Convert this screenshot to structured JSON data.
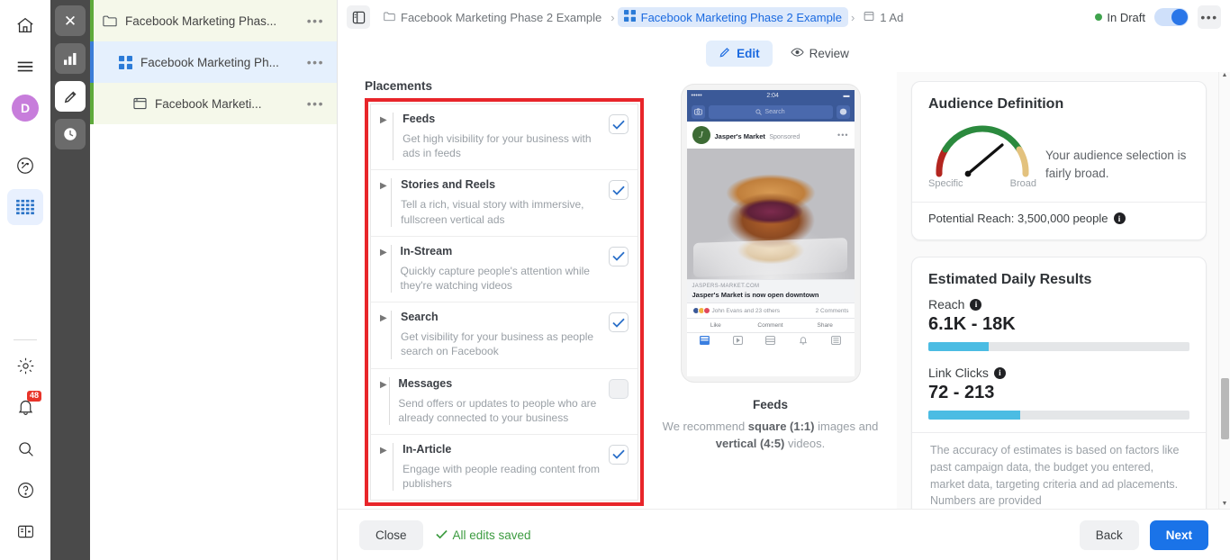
{
  "rail": {
    "items": [
      {
        "name": "home-icon",
        "label": "Home"
      },
      {
        "name": "menu-icon",
        "label": "Menu"
      },
      {
        "name": "avatar",
        "label": "D"
      },
      {
        "name": "speedometer-icon",
        "label": "Dashboard"
      },
      {
        "name": "grid-table-icon",
        "label": "Table"
      }
    ],
    "bottom": [
      {
        "name": "gear-icon",
        "label": "Settings"
      },
      {
        "name": "bell-icon",
        "label": "Notifications",
        "badge": "48"
      },
      {
        "name": "search-icon",
        "label": "Search"
      },
      {
        "name": "help-icon",
        "label": "Help"
      },
      {
        "name": "panel-icon",
        "label": "Toggle panel"
      }
    ]
  },
  "toolcol": {
    "items": [
      {
        "name": "close-icon",
        "label": "Close"
      },
      {
        "name": "chart-bars-icon",
        "label": "Analytics"
      },
      {
        "name": "pencil-icon",
        "label": "Edit"
      },
      {
        "name": "clock-icon",
        "label": "History"
      }
    ]
  },
  "tree": {
    "items": [
      {
        "label": "Facebook Marketing Phas...",
        "icon": "folder-icon",
        "menu": "•••"
      },
      {
        "label": "Facebook Marketing Ph...",
        "icon": "campaign-grid-icon",
        "menu": "•••"
      },
      {
        "label": "Facebook Marketi...",
        "icon": "ad-window-icon",
        "menu": "•••"
      }
    ]
  },
  "topbar": {
    "breadcrumb": [
      {
        "label": "Facebook Marketing Phase 2 Example",
        "icon": "folder-icon"
      },
      {
        "label": "Facebook Marketing Phase 2 Example",
        "icon": "campaign-grid-icon"
      },
      {
        "label": "1 Ad",
        "icon": "ad-window-icon"
      }
    ],
    "separator": "›",
    "status_label": "In Draft",
    "status_color": "#3fa34d",
    "kebab": "•••"
  },
  "tabs": [
    {
      "label": "Edit",
      "icon": "pencil-icon",
      "active": true
    },
    {
      "label": "Review",
      "icon": "eye-icon",
      "active": false
    }
  ],
  "placements": {
    "section_title": "Placements",
    "highlight_color": "#e8252a",
    "items": [
      {
        "title": "Feeds",
        "description": "Get high visibility for your business with ads in feeds",
        "checked": true
      },
      {
        "title": "Stories and Reels",
        "description": "Tell a rich, visual story with immersive, fullscreen vertical ads",
        "checked": true
      },
      {
        "title": "In-Stream",
        "description": "Quickly capture people's attention while they're watching videos",
        "checked": true
      },
      {
        "title": "Search",
        "description": "Get visibility for your business as people search on Facebook",
        "checked": true
      },
      {
        "title": "Messages",
        "description": "Send offers or updates to people who are already connected to your business",
        "checked": false
      },
      {
        "title": "In-Article",
        "description": "Engage with people reading content from publishers",
        "checked": true
      }
    ]
  },
  "preview": {
    "title": "Feeds",
    "recommend_prefix": "We recommend ",
    "recommend_bold1": "square (1:1)",
    "recommend_mid": " images and ",
    "recommend_bold2": "vertical (4:5)",
    "recommend_suffix": " videos.",
    "phone": {
      "time": "2:04",
      "signal": "•••••",
      "search_placeholder": "Search",
      "page_name": "Jasper's Market",
      "sponsored": "Sponsored",
      "link_url": "JASPERS-MARKET.COM",
      "link_title": "Jasper's Market is now open downtown",
      "reactions": "John Evans and 23 others",
      "comments": "2 Comments",
      "actions": [
        "Like",
        "Comment",
        "Share"
      ]
    }
  },
  "audience": {
    "card_title": "Audience Definition",
    "gauge_left_label": "Specific",
    "gauge_right_label": "Broad",
    "note": "Your audience selection is fairly broad.",
    "reach_label": "Potential Reach: 3,500,000 people",
    "info_glyph": "i"
  },
  "estimates": {
    "card_title": "Estimated Daily Results",
    "metrics": [
      {
        "label": "Reach",
        "value": "6.1K - 18K",
        "fill_percent": 23
      },
      {
        "label": "Link Clicks",
        "value": "72 - 213",
        "fill_percent": 35
      }
    ],
    "bar_color": "#4bbce3",
    "disclaimer": "The accuracy of estimates is based on factors like past campaign data, the budget you entered, market data, targeting criteria and ad placements. Numbers are provided",
    "info_glyph": "i"
  },
  "bottombar": {
    "close_label": "Close",
    "saved_label": "All edits saved",
    "back_label": "Back",
    "next_label": "Next"
  }
}
